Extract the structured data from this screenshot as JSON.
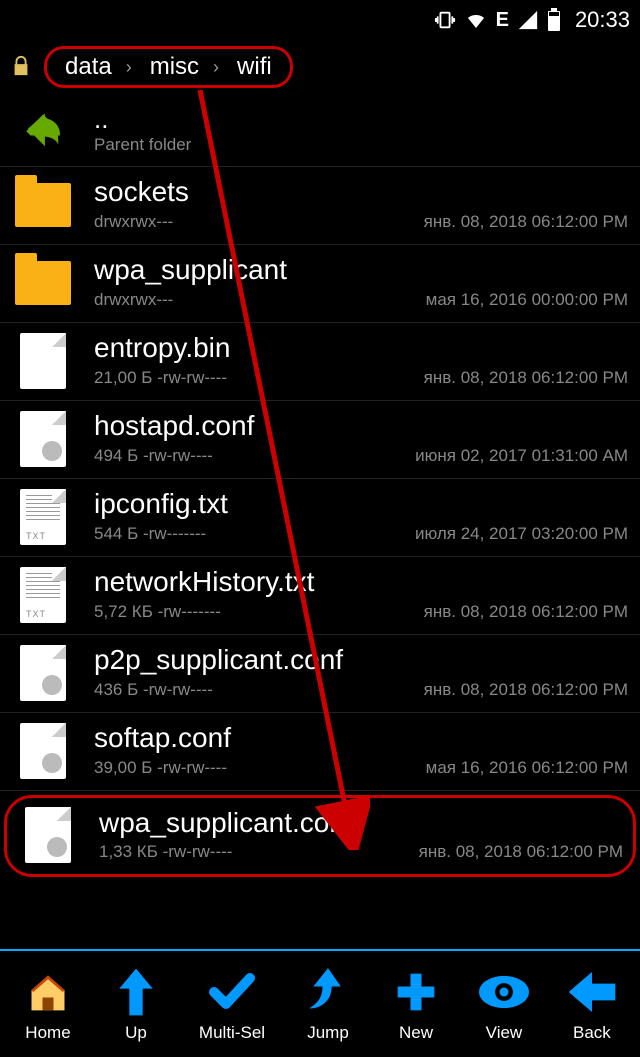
{
  "statusbar": {
    "time": "20:33"
  },
  "breadcrumb": [
    "data",
    "misc",
    "wifi"
  ],
  "parent": {
    "dots": "..",
    "label": "Parent folder"
  },
  "items": [
    {
      "name": "sockets",
      "meta": "drwxrwx---",
      "date": "янв. 08, 2018 06:12:00 PM",
      "type": "folder"
    },
    {
      "name": "wpa_supplicant",
      "meta": "drwxrwx---",
      "date": "мая 16, 2016 00:00:00 PM",
      "type": "folder"
    },
    {
      "name": "entropy.bin",
      "meta": "21,00 Б -rw-rw----",
      "date": "янв. 08, 2018 06:12:00 PM",
      "type": "file"
    },
    {
      "name": "hostapd.conf",
      "meta": "494 Б -rw-rw----",
      "date": "июня 02, 2017 01:31:00 AM",
      "type": "conf"
    },
    {
      "name": "ipconfig.txt",
      "meta": "544 Б -rw-------",
      "date": "июля 24, 2017 03:20:00 PM",
      "type": "txt"
    },
    {
      "name": "networkHistory.txt",
      "meta": "5,72 КБ -rw-------",
      "date": "янв. 08, 2018 06:12:00 PM",
      "type": "txt"
    },
    {
      "name": "p2p_supplicant.conf",
      "meta": "436 Б -rw-rw----",
      "date": "янв. 08, 2018 06:12:00 PM",
      "type": "conf"
    },
    {
      "name": "softap.conf",
      "meta": "39,00 Б -rw-rw----",
      "date": "мая 16, 2016 06:12:00 PM",
      "type": "conf"
    },
    {
      "name": "wpa_supplicant.conf",
      "meta": "1,33 КБ -rw-rw----",
      "date": "янв. 08, 2018 06:12:00 PM",
      "type": "conf",
      "highlighted": true
    }
  ],
  "toolbar": [
    {
      "id": "home",
      "label": "Home"
    },
    {
      "id": "up",
      "label": "Up"
    },
    {
      "id": "multisel",
      "label": "Multi-Sel"
    },
    {
      "id": "jump",
      "label": "Jump"
    },
    {
      "id": "new",
      "label": "New"
    },
    {
      "id": "view",
      "label": "View"
    },
    {
      "id": "back",
      "label": "Back"
    }
  ]
}
